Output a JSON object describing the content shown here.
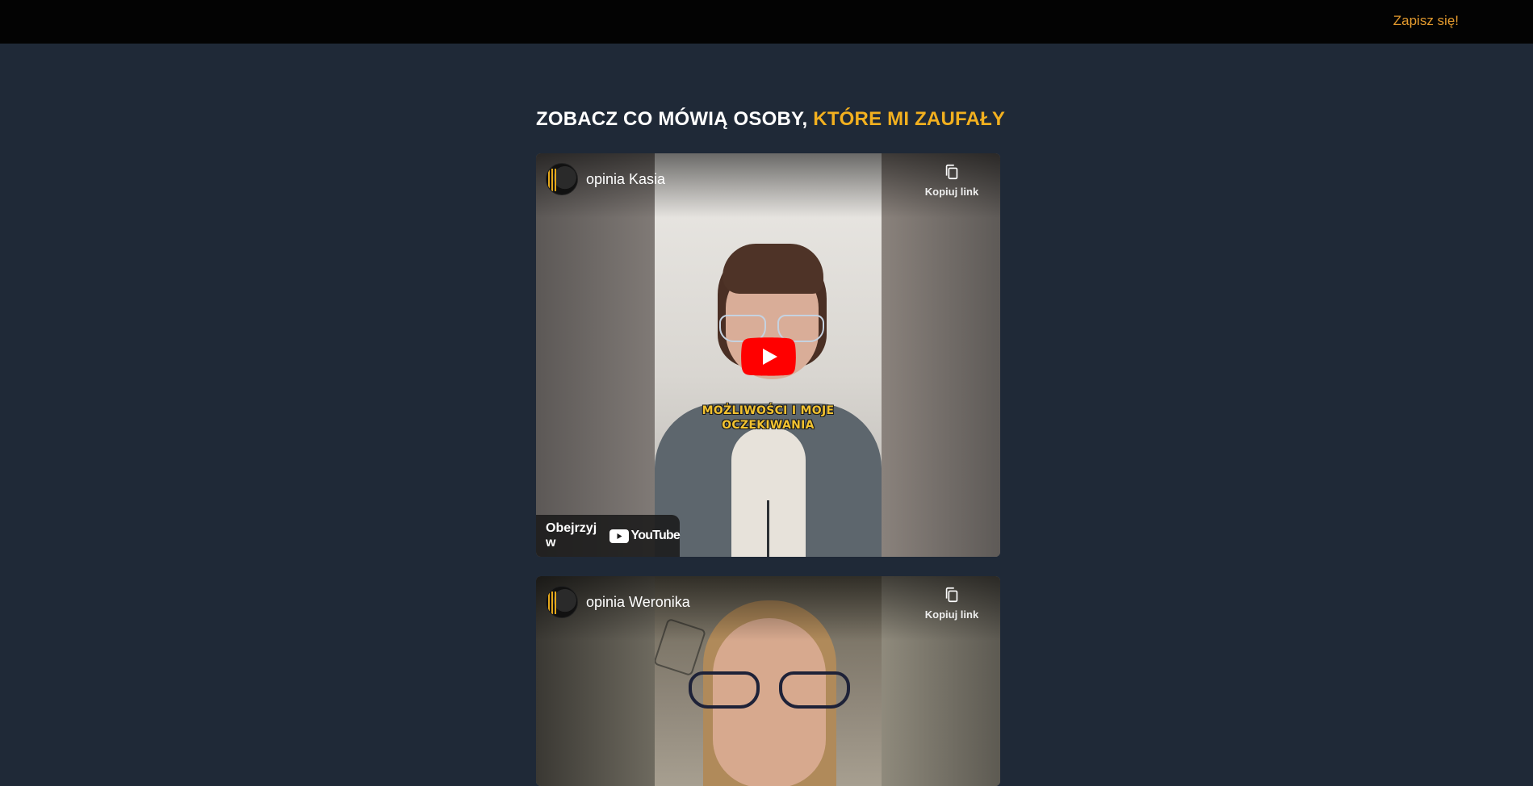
{
  "header": {
    "signup_label": "Zapisz się!"
  },
  "section": {
    "heading_plain": "ZOBACZ CO MÓWIĄ OSOBY,",
    "heading_accent": "KTÓRE MI ZAUFAŁY"
  },
  "videos": [
    {
      "title": "opinia Kasia",
      "copy_link_label": "Kopiuj link",
      "caption_line1": "MOŻLIWOŚCI I MOJE",
      "caption_line2": "OCZEKIWANIA",
      "watch_on_label": "Obejrzyj w",
      "youtube_label": "YouTube"
    },
    {
      "title": "opinia Weronika",
      "copy_link_label": "Kopiuj link"
    }
  ],
  "colors": {
    "background": "#1f2937",
    "topbar": "#030303",
    "signup": "#e39a2e",
    "accent": "#f2b01f",
    "youtube_red": "#ff0000"
  },
  "icons": {
    "copy": "copy-icon",
    "play": "play-icon",
    "youtube": "youtube-logo-icon"
  }
}
